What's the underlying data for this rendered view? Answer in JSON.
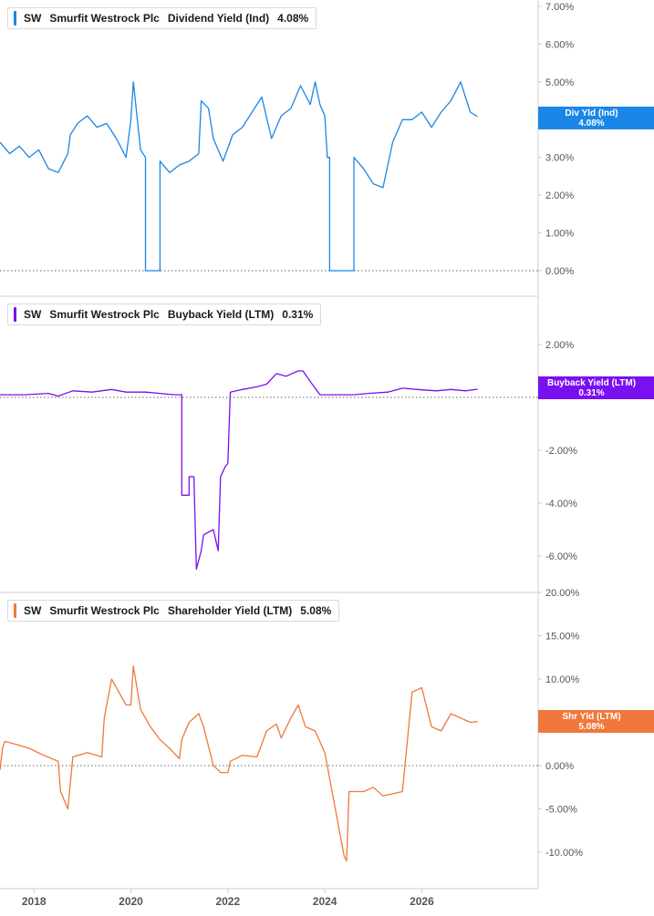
{
  "colors": {
    "dividend": "#1a86e8",
    "buyback": "#7a0ff0",
    "shareholder": "#f0783c",
    "axis_text": "#555555",
    "grid": "#cccccc"
  },
  "chart_data": [
    {
      "type": "line",
      "ticker": "SW",
      "company": "Smurfit Westrock Plc",
      "metric": "Dividend Yield (Ind)",
      "latest_value": "4.08%",
      "tag_label": "Div Yld (Ind)",
      "tag_value": "4.08%",
      "y_ticks": [
        "7.00%",
        "6.00%",
        "5.00%",
        "4.00%",
        "3.00%",
        "2.00%",
        "1.00%",
        "0.00%"
      ],
      "ylim": [
        0,
        7
      ],
      "series": [
        {
          "x": [
            2017.3,
            2017.5,
            2017.7,
            2017.9,
            2018.1,
            2018.3,
            2018.5,
            2018.7,
            2018.75,
            2018.9,
            2019.1,
            2019.3,
            2019.5,
            2019.7,
            2019.9,
            2020.0,
            2020.05,
            2020.2,
            2020.3,
            2020.3,
            2020.6,
            2020.6,
            2020.8,
            2021.0,
            2021.2,
            2021.4,
            2021.45,
            2021.6,
            2021.7,
            2021.9,
            2022.1,
            2022.3,
            2022.5,
            2022.7,
            2022.9,
            2023.1,
            2023.3,
            2023.5,
            2023.7,
            2023.8,
            2023.9,
            2024.0,
            2024.05,
            2024.1,
            2024.1,
            2024.6,
            2024.6,
            2024.8,
            2025.0,
            2025.2,
            2025.4,
            2025.6,
            2025.8,
            2026.0,
            2026.2,
            2026.4,
            2026.6,
            2026.8,
            2027.0,
            2027.15
          ],
          "y": [
            3.4,
            3.1,
            3.3,
            3.0,
            3.2,
            2.7,
            2.6,
            3.1,
            3.6,
            3.9,
            4.1,
            3.8,
            3.9,
            3.5,
            3.0,
            4.0,
            5.0,
            3.2,
            3.0,
            0.0,
            0.0,
            2.9,
            2.6,
            2.8,
            2.9,
            3.1,
            4.5,
            4.3,
            3.5,
            2.9,
            3.6,
            3.8,
            4.2,
            4.6,
            3.5,
            4.1,
            4.3,
            4.9,
            4.4,
            5.0,
            4.4,
            4.1,
            3.0,
            3.0,
            0.0,
            0.0,
            3.0,
            2.7,
            2.3,
            2.2,
            3.4,
            4.0,
            4.0,
            4.2,
            3.8,
            4.2,
            4.5,
            5.0,
            4.2,
            4.08
          ]
        }
      ]
    },
    {
      "type": "line",
      "ticker": "SW",
      "company": "Smurfit Westrock Plc",
      "metric": "Buyback Yield (LTM)",
      "latest_value": "0.31%",
      "tag_label": "Buyback Yield (LTM)",
      "tag_value": "0.31%",
      "y_ticks": [
        "2.00%",
        "-2.00%",
        "-4.00%",
        "-6.00%"
      ],
      "ylim": [
        -7.5,
        3.0
      ],
      "series": [
        {
          "x": [
            2017.3,
            2017.8,
            2018.3,
            2018.5,
            2018.8,
            2019.2,
            2019.6,
            2019.9,
            2020.3,
            2020.6,
            2020.9,
            2021.0,
            2021.05,
            2021.05,
            2021.2,
            2021.2,
            2021.3,
            2021.35,
            2021.45,
            2021.5,
            2021.7,
            2021.8,
            2021.85,
            2021.9,
            2021.95,
            2022.0,
            2022.05,
            2022.3,
            2022.6,
            2022.8,
            2023.0,
            2023.2,
            2023.45,
            2023.55,
            2023.7,
            2023.9,
            2024.2,
            2024.6,
            2024.9,
            2025.3,
            2025.6,
            2025.9,
            2026.3,
            2026.6,
            2026.9,
            2027.15
          ],
          "y": [
            0.1,
            0.1,
            0.15,
            0.05,
            0.25,
            0.2,
            0.3,
            0.2,
            0.2,
            0.15,
            0.1,
            0.1,
            0.1,
            -3.7,
            -3.7,
            -3.0,
            -3.0,
            -6.5,
            -5.8,
            -5.2,
            -5.0,
            -5.8,
            -3.0,
            -2.8,
            -2.6,
            -2.5,
            0.2,
            0.3,
            0.4,
            0.5,
            0.9,
            0.8,
            1.0,
            1.0,
            0.6,
            0.1,
            0.1,
            0.1,
            0.15,
            0.2,
            0.35,
            0.3,
            0.25,
            0.3,
            0.25,
            0.31
          ]
        }
      ]
    },
    {
      "type": "line",
      "ticker": "SW",
      "company": "Smurfit Westrock Plc",
      "metric": "Shareholder Yield (LTM)",
      "latest_value": "5.08%",
      "tag_label": "Shr Yld (LTM)",
      "tag_value": "5.08%",
      "y_ticks": [
        "20.00%",
        "15.00%",
        "10.00%",
        "5.00%",
        "0.00%",
        "-5.00%",
        "-10.00%"
      ],
      "ylim": [
        -14,
        20
      ],
      "series": [
        {
          "x": [
            2017.3,
            2017.35,
            2017.4,
            2017.6,
            2017.9,
            2018.2,
            2018.5,
            2018.55,
            2018.7,
            2018.8,
            2018.8,
            2019.1,
            2019.4,
            2019.45,
            2019.6,
            2019.8,
            2019.9,
            2020.0,
            2020.05,
            2020.2,
            2020.4,
            2020.6,
            2020.8,
            2021.0,
            2021.05,
            2021.2,
            2021.4,
            2021.5,
            2021.7,
            2021.8,
            2021.85,
            2021.95,
            2022.0,
            2022.05,
            2022.3,
            2022.6,
            2022.8,
            2022.8,
            2023.0,
            2023.1,
            2023.3,
            2023.45,
            2023.6,
            2023.8,
            2024.0,
            2024.4,
            2024.45,
            2024.5,
            2024.8,
            2025.0,
            2025.2,
            2025.6,
            2025.8,
            2026.0,
            2026.2,
            2026.4,
            2026.6,
            2026.8,
            2027.0,
            2027.15
          ],
          "y": [
            -0.5,
            2.0,
            2.8,
            2.5,
            2.0,
            1.2,
            0.5,
            -3.0,
            -5.0,
            0.8,
            1.0,
            1.5,
            1.0,
            5.5,
            10.0,
            8.0,
            7.0,
            7.0,
            11.5,
            6.5,
            4.5,
            3.0,
            2.0,
            0.8,
            3.0,
            5.0,
            6.0,
            4.5,
            0.0,
            -0.5,
            -0.8,
            -0.8,
            -0.8,
            0.5,
            1.2,
            1.0,
            4.0,
            4.0,
            4.8,
            3.2,
            5.5,
            7.0,
            4.5,
            4.0,
            1.5,
            -10.5,
            -11.0,
            -3.0,
            -3.0,
            -2.5,
            -3.5,
            -3.0,
            8.5,
            9.0,
            4.5,
            4.0,
            6.0,
            5.5,
            5.0,
            5.08
          ]
        }
      ]
    }
  ],
  "x_axis": {
    "ticks": [
      "2018",
      "2020",
      "2022",
      "2024",
      "2026"
    ],
    "tick_values": [
      2018,
      2020,
      2022,
      2024,
      2026
    ],
    "xlim": [
      2017.3,
      2028.4
    ]
  }
}
